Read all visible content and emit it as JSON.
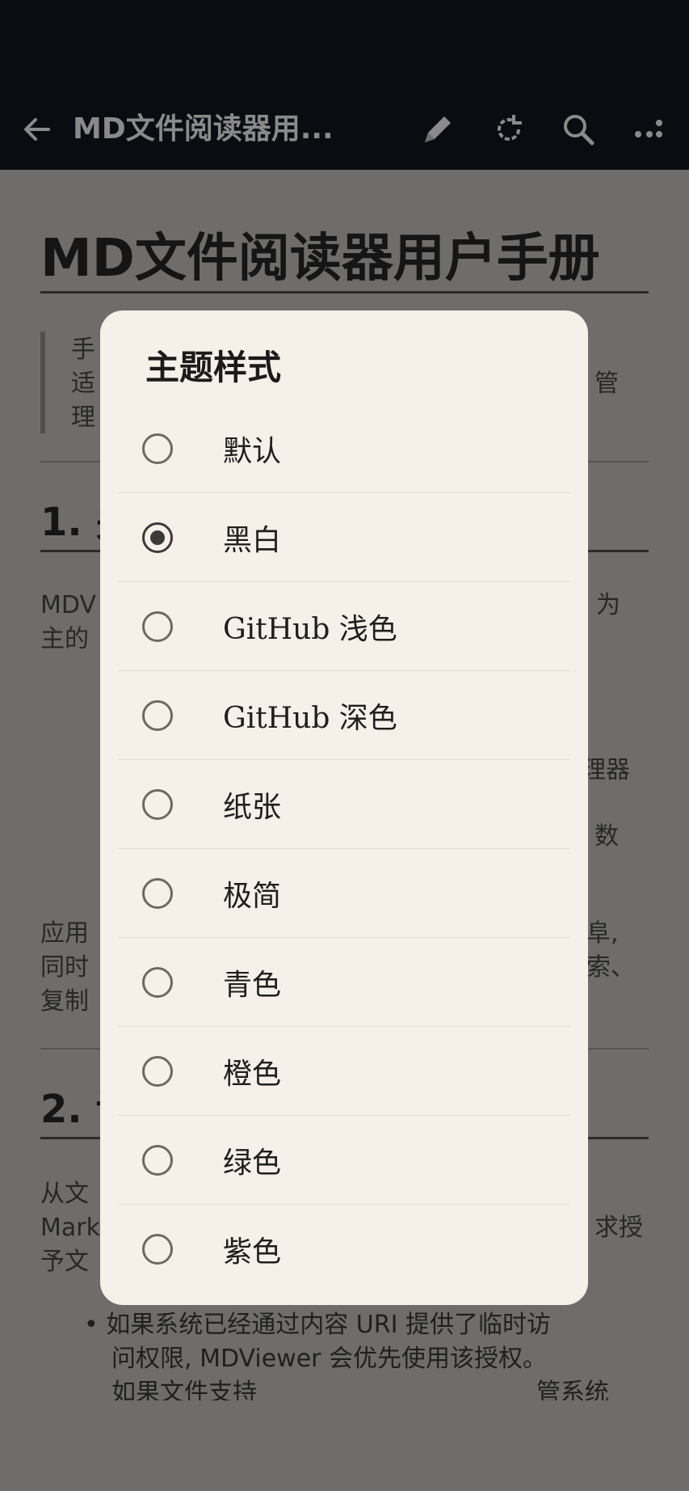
{
  "appbar": {
    "title": "MD文件阅读器用...",
    "icons": [
      "back-arrow-icon",
      "edit-pencil-icon",
      "refresh-icon",
      "search-icon",
      "more-icon"
    ]
  },
  "document": {
    "heading": "MD文件阅读器用户手册",
    "quote_lines": [
      "手",
      "适",
      "理"
    ],
    "quote_right": "管",
    "section1_heading": "1. 关",
    "para1_line1_left": "MDV",
    "para1_line1_right": "为",
    "para1_line2_left": "主的",
    "list_right_1": "理器",
    "list_right_2": "数",
    "para2_line1_left": "应用",
    "para2_line1_right": "阜,",
    "para2_line2_left": "同时",
    "para2_line2_right": "索、",
    "para2_line3_left": "复制",
    "section2_heading": "2. 访",
    "para3_line1_left": "从文",
    "para3_line2_left": "Mark",
    "para3_line2_right": "求授",
    "para3_line3_left": "予文",
    "bullet_line1": "• 如果系统已经通过内容 URI 提供了临时访",
    "bullet_line2": "问权限, MDViewer 会优先使用该授权。",
    "bullet_line3_left": "如果文件支持",
    "bullet_line3_right": "管系统"
  },
  "dialog": {
    "title": "主题样式",
    "options": [
      {
        "label": "默认",
        "checked": false
      },
      {
        "label": "黑白",
        "checked": true
      },
      {
        "label": "GitHub 浅色",
        "checked": false
      },
      {
        "label": "GitHub 深色",
        "checked": false
      },
      {
        "label": "纸张",
        "checked": false
      },
      {
        "label": "极简",
        "checked": false
      },
      {
        "label": "青色",
        "checked": false
      },
      {
        "label": "橙色",
        "checked": false
      },
      {
        "label": "绿色",
        "checked": false
      },
      {
        "label": "紫色",
        "checked": false
      }
    ]
  }
}
